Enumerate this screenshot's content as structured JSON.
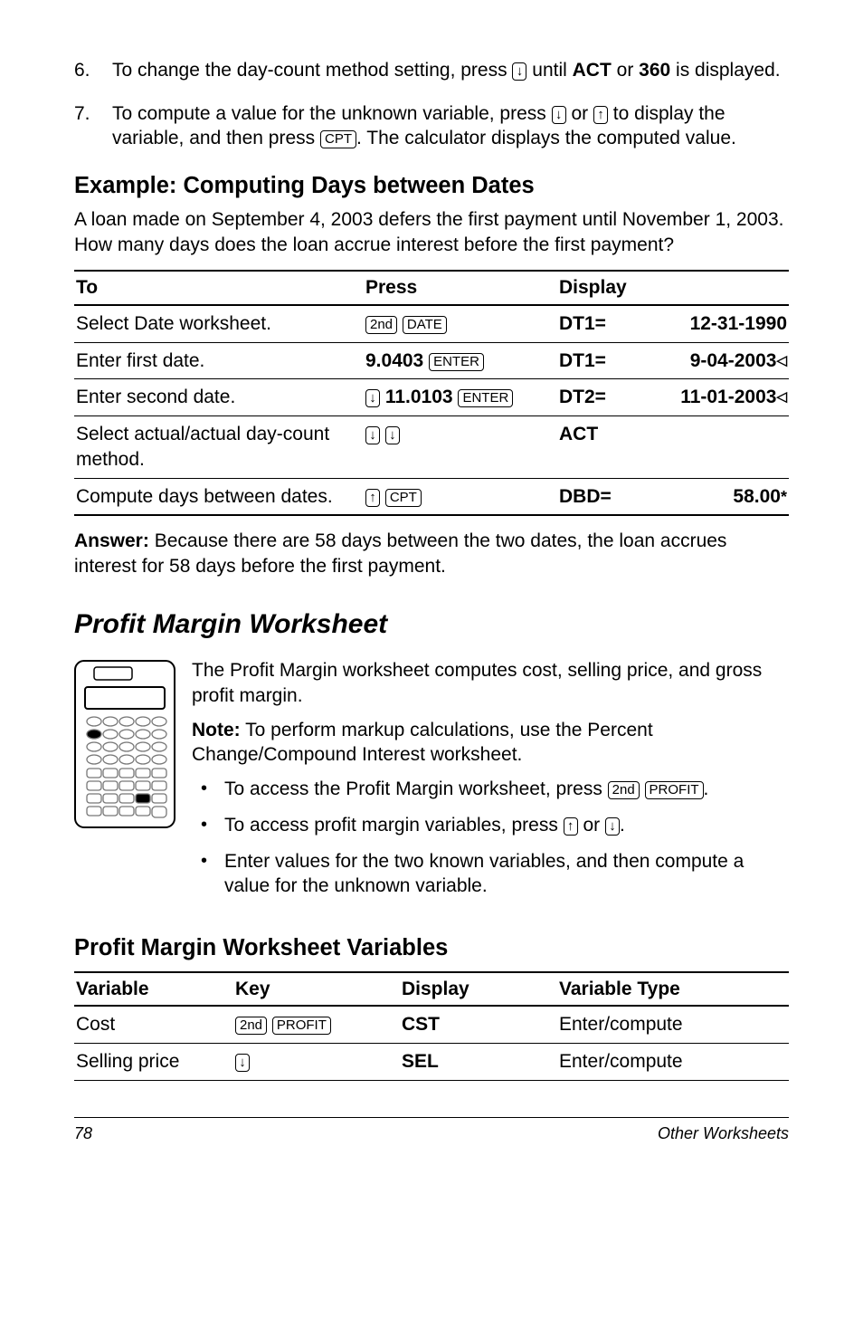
{
  "steps": {
    "six": {
      "num": "6.",
      "pre": "To change the day-count method setting, press ",
      "key": "↓",
      "mid": " until ",
      "b1": "ACT",
      "or": " or ",
      "b2": "360",
      "post": " is displayed."
    },
    "seven": {
      "num": "7.",
      "pre": "To compute a value for the unknown variable, press ",
      "k1": "↓",
      "or": " or ",
      "k2": "↑",
      "mid": " to display the variable, and then press ",
      "k3": "CPT",
      "post": ". The calculator displays the computed value."
    }
  },
  "example": {
    "heading": "Example: Computing Days between Dates",
    "intro": "A loan made on September 4, 2003 defers the first payment until November 1, 2003. How many days does the loan accrue interest before the first payment?",
    "th": {
      "to": "To",
      "press": "Press",
      "display": "Display"
    },
    "rows": [
      {
        "to": "Select Date worksheet.",
        "press_keys": [
          "2nd",
          "DATE"
        ],
        "disp": "DT1=",
        "val": "12-31-1990"
      },
      {
        "to": "Enter first date.",
        "press_b": "9.0403",
        "press_keys2": [
          "ENTER"
        ],
        "disp": "DT1=",
        "val": "9-04-2003",
        "tri": true
      },
      {
        "to": "Enter second date.",
        "press_keys_lead": [
          "↓"
        ],
        "press_b": "11.0103",
        "press_keys2": [
          "ENTER"
        ],
        "disp": "DT2=",
        "val": "11-01-2003",
        "tri": true
      },
      {
        "to": "Select actual/actual day-count method.",
        "press_keys": [
          "↓",
          "↓"
        ],
        "disp": "ACT",
        "val": ""
      },
      {
        "to": "Compute days between dates.",
        "press_keys": [
          "↑",
          "CPT"
        ],
        "disp": "DBD=",
        "val": "58.00",
        "ast": true
      }
    ],
    "answer_label": "Answer:",
    "answer_text": " Because there are 58 days between the two dates, the loan accrues interest for 58 days before the first payment."
  },
  "profit": {
    "heading": "Profit Margin Worksheet",
    "p1": "The Profit Margin worksheet computes cost, selling price, and gross profit margin.",
    "note_label": "Note:",
    "note_text": " To perform markup calculations, use the Percent Change/Compound Interest worksheet.",
    "b1_pre": "To access the Profit Margin worksheet, press ",
    "b1_k1": "2nd",
    "b1_k2": "PROFIT",
    "b1_post": ".",
    "b2_pre": "To access profit margin variables, press ",
    "b2_k1": "↑",
    "b2_or": " or ",
    "b2_k2": "↓",
    "b2_post": ".",
    "b3": "Enter values for the two known variables, and then compute a value for the unknown variable."
  },
  "vars": {
    "heading": "Profit Margin Worksheet Variables",
    "th": {
      "var": "Variable",
      "key": "Key",
      "disp": "Display",
      "type": "Variable Type"
    },
    "rows": [
      {
        "var": "Cost",
        "keys": [
          "2nd",
          "PROFIT"
        ],
        "disp": "CST",
        "type": "Enter/compute"
      },
      {
        "var": "Selling price",
        "keys": [
          "↓"
        ],
        "disp": "SEL",
        "type": "Enter/compute"
      }
    ]
  },
  "footer": {
    "page": "78",
    "title": "Other Worksheets"
  }
}
